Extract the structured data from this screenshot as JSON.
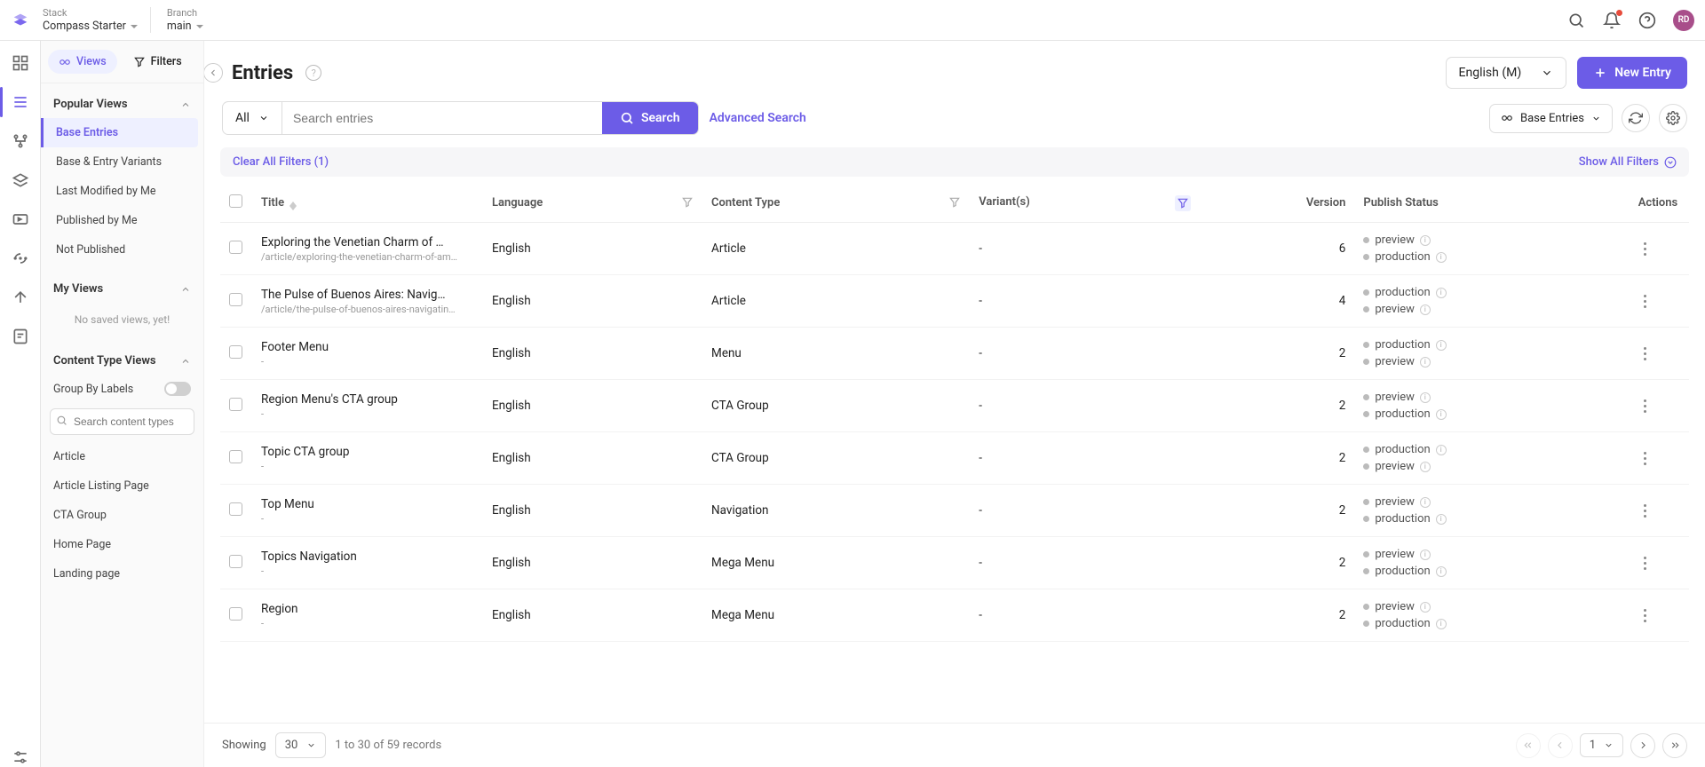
{
  "topbar": {
    "stack_label": "Stack",
    "stack_value": "Compass Starter",
    "branch_label": "Branch",
    "branch_value": "main",
    "avatar": "RD"
  },
  "sidebar": {
    "views_tab": "Views",
    "filters_tab": "Filters",
    "popular_header": "Popular Views",
    "popular": [
      "Base Entries",
      "Base & Entry Variants",
      "Last Modified by Me",
      "Published by Me",
      "Not Published"
    ],
    "my_views_header": "My Views",
    "my_views_empty": "No saved views, yet!",
    "ctv_header": "Content Type Views",
    "group_by": "Group By Labels",
    "ct_search_ph": "Search content types",
    "ct_items": [
      "Article",
      "Article Listing Page",
      "CTA Group",
      "Home Page",
      "Landing page"
    ]
  },
  "header": {
    "title": "Entries",
    "lang": "English (M)",
    "new_entry": "New Entry"
  },
  "search": {
    "scope": "All",
    "placeholder": "Search entries",
    "button": "Search",
    "advanced": "Advanced Search",
    "base_entries": "Base Entries"
  },
  "filters": {
    "clear": "Clear All Filters (1)",
    "show": "Show All Filters"
  },
  "columns": {
    "title": "Title",
    "language": "Language",
    "content_type": "Content Type",
    "variants": "Variant(s)",
    "version": "Version",
    "publish_status": "Publish Status",
    "actions": "Actions"
  },
  "rows": [
    {
      "title": "Exploring the Venetian Charm of …",
      "sub": "/article/exploring-the-venetian-charm-of-am…",
      "lang": "English",
      "ct": "Article",
      "variant": "-",
      "ver": "6",
      "status": [
        "preview",
        "production"
      ]
    },
    {
      "title": "The Pulse of Buenos Aires: Navig…",
      "sub": "/article/the-pulse-of-buenos-aires-navigatin…",
      "lang": "English",
      "ct": "Article",
      "variant": "-",
      "ver": "4",
      "status": [
        "production",
        "preview"
      ]
    },
    {
      "title": "Footer Menu",
      "sub": "-",
      "lang": "English",
      "ct": "Menu",
      "variant": "-",
      "ver": "2",
      "status": [
        "production",
        "preview"
      ]
    },
    {
      "title": "Region Menu's CTA group",
      "sub": "-",
      "lang": "English",
      "ct": "CTA Group",
      "variant": "-",
      "ver": "2",
      "status": [
        "preview",
        "production"
      ]
    },
    {
      "title": "Topic CTA group",
      "sub": "-",
      "lang": "English",
      "ct": "CTA Group",
      "variant": "-",
      "ver": "2",
      "status": [
        "production",
        "preview"
      ]
    },
    {
      "title": "Top Menu",
      "sub": "-",
      "lang": "English",
      "ct": "Navigation",
      "variant": "-",
      "ver": "2",
      "status": [
        "preview",
        "production"
      ]
    },
    {
      "title": "Topics Navigation",
      "sub": "-",
      "lang": "English",
      "ct": "Mega Menu",
      "variant": "-",
      "ver": "2",
      "status": [
        "preview",
        "production"
      ]
    },
    {
      "title": "Region",
      "sub": "-",
      "lang": "English",
      "ct": "Mega Menu",
      "variant": "-",
      "ver": "2",
      "status": [
        "preview",
        "production"
      ]
    }
  ],
  "pager": {
    "showing": "Showing",
    "per_page": "30",
    "range": "1 to 30 of 59 records",
    "page": "1"
  }
}
